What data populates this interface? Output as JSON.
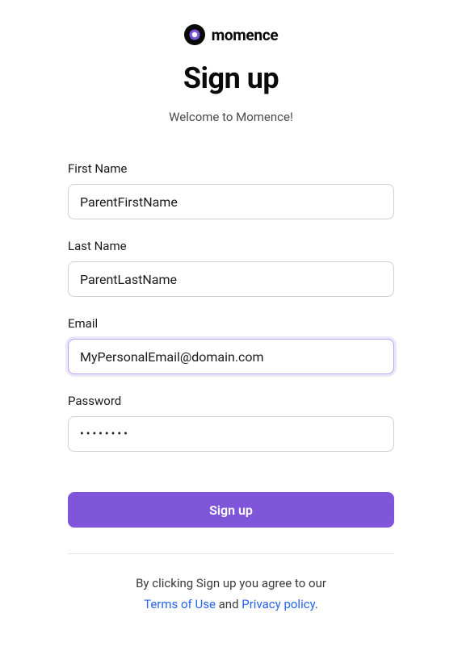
{
  "brand": {
    "name": "momence"
  },
  "page": {
    "title": "Sign up",
    "subtitle": "Welcome to Momence!"
  },
  "form": {
    "firstName": {
      "label": "First Name",
      "value": "ParentFirstName"
    },
    "lastName": {
      "label": "Last Name",
      "value": "ParentLastName"
    },
    "email": {
      "label": "Email",
      "value": "MyPersonalEmail@domain.com"
    },
    "password": {
      "label": "Password",
      "value": "••••••••"
    },
    "submitLabel": "Sign up"
  },
  "terms": {
    "prefix": "By clicking Sign up you agree to our",
    "termsLink": "Terms of Use",
    "connector": " and ",
    "privacyLink": "Privacy policy",
    "suffix": "."
  }
}
